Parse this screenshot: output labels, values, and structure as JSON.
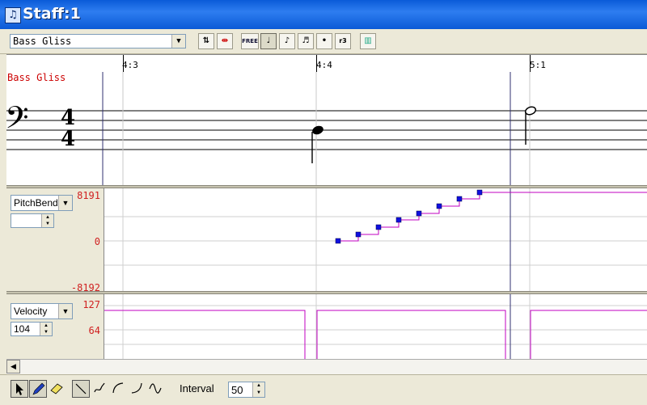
{
  "window": {
    "title": "Staff:1",
    "icon": "music-notes-icon"
  },
  "toolbar": {
    "track_select": "Bass Gliss",
    "buttons": [
      {
        "name": "quantize-icon",
        "glyph": "⇅"
      },
      {
        "name": "split-icon",
        "glyph": "⇹"
      },
      {
        "name": "free-button",
        "glyph": "FREE"
      },
      {
        "name": "quarter-note-icon",
        "glyph": "♩"
      },
      {
        "name": "eighth-note-icon",
        "glyph": "♪"
      },
      {
        "name": "sixteenth-note-icon",
        "glyph": "♬"
      },
      {
        "name": "dot-icon",
        "glyph": "•"
      },
      {
        "name": "triplet-icon",
        "glyph": "r3"
      },
      {
        "name": "color-bars-icon",
        "glyph": "▥"
      }
    ]
  },
  "ruler": {
    "markers": [
      "4:3",
      "4:4",
      "5:1"
    ]
  },
  "staff": {
    "track_label": "Bass Gliss",
    "time_sig_top": "4",
    "time_sig_bottom": "4",
    "clef": "𝄢"
  },
  "pitchbend": {
    "controller": "PitchBend",
    "value": "",
    "max_label": "8191",
    "mid_label": "0",
    "min_label": "-8192"
  },
  "velocity": {
    "controller": "Velocity",
    "value": "104",
    "max_label": "127",
    "mid_label": "64"
  },
  "bottom": {
    "interval_label": "Interval",
    "interval_value": "50"
  },
  "colors": {
    "accent": "#0a5bd8",
    "curve": "#c000c0",
    "point": "#1010e0",
    "label_red": "#d02020"
  }
}
